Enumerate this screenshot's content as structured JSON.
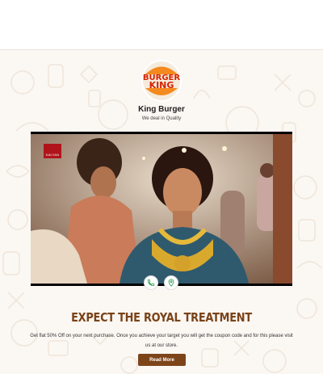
{
  "brand": {
    "logo_line1": "BURGER",
    "logo_line2": "KING",
    "name": "King Burger",
    "tagline": "We deal in Quality"
  },
  "video": {
    "badge_text": "KALYAN",
    "icon": "video-frame"
  },
  "actions": {
    "call_icon": "phone-icon",
    "location_icon": "location-pin-icon"
  },
  "promo": {
    "headline": "EXPECT THE ROYAL TREATMENT",
    "description": "Get flat 50% Off on your next purchase. Once you achieve your target you will get the coupon code and for this please visit us at our store.",
    "button_label": "Read More"
  },
  "colors": {
    "accent": "#7e4419",
    "headline": "#7a4318",
    "background": "#fbf7f3",
    "logo_orange": "#f48a1f",
    "logo_red": "#d62300",
    "action_green": "#2e9d4d"
  }
}
